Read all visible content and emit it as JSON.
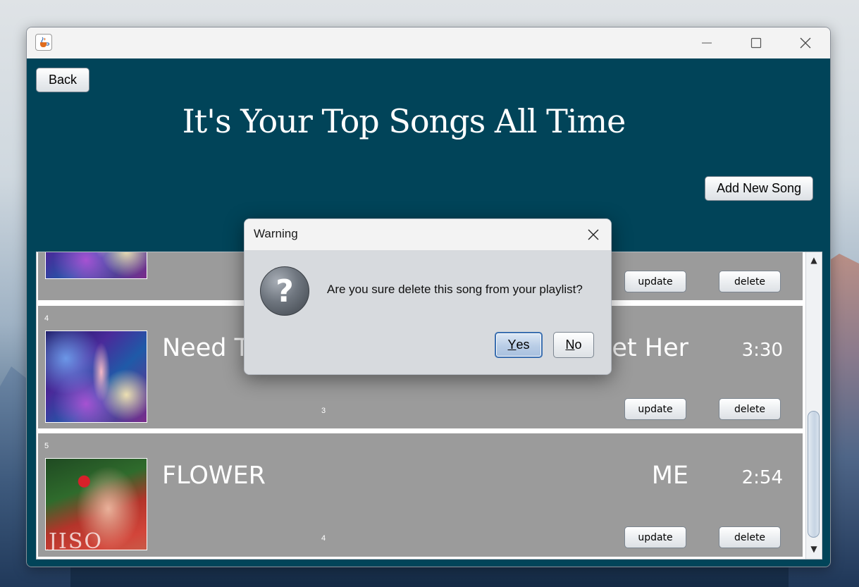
{
  "window": {
    "icon": "java-coffee-icon",
    "controls": {
      "minimize": "minimize-icon",
      "maximize": "maximize-icon",
      "close": "close-icon"
    }
  },
  "header": {
    "back_label": "Back",
    "title": "It's Your Top Songs All Time",
    "add_label": "Add New Song"
  },
  "songs": [
    {
      "index": "",
      "title": "",
      "artist": "",
      "duration": "",
      "plays": "",
      "cover": "cover-neon-dancer"
    },
    {
      "index": "4",
      "title": "Need To Meet Her",
      "artist": "Meet Her",
      "duration": "3:30",
      "plays": "3",
      "cover": "cover-neon-dancer"
    },
    {
      "index": "5",
      "title": "FLOWER",
      "artist": "ME",
      "duration": "2:54",
      "plays": "4",
      "cover": "cover-red-flower",
      "cover_text": "JISO"
    }
  ],
  "row_buttons": {
    "update": "update",
    "delete": "delete"
  },
  "dialog": {
    "title": "Warning",
    "message": "Are you sure delete this song from your playlist?",
    "icon": "question-icon",
    "yes_mnemonic": "Y",
    "yes_rest": "es",
    "no_mnemonic": "N",
    "no_rest": "o"
  },
  "colors": {
    "app_background": "#014459",
    "row_background": "#9b9b9b",
    "text": "#ffffff",
    "default_button_border": "#3b6fb0"
  }
}
